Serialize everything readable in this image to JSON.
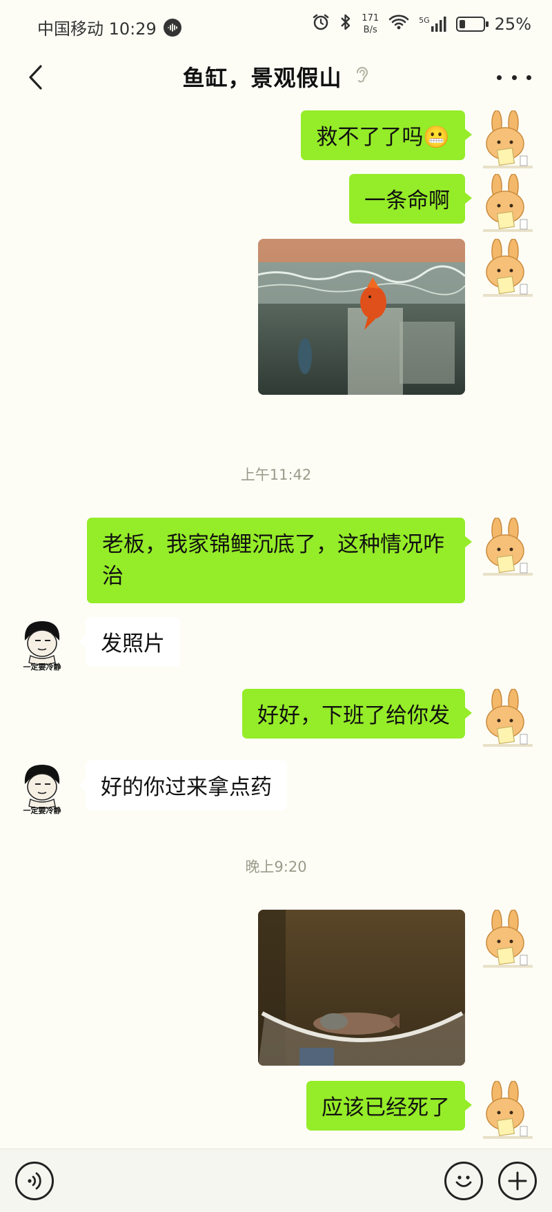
{
  "status_bar": {
    "carrier_time": "中国移动 10:29",
    "net_speed_value": "171",
    "net_speed_unit": "B/s",
    "network_type": "5G",
    "battery_percent": "25%",
    "battery_level": 0.25
  },
  "nav": {
    "title": "鱼缸，景观假山",
    "back_icon": "chevron-left-icon",
    "more_icon": "more-horizontal-icon",
    "mute_icon": "ear-icon"
  },
  "messages": [
    {
      "sender": "me",
      "type": "text",
      "text": "救不了了吗😬"
    },
    {
      "sender": "me",
      "type": "text",
      "text": "一条命啊"
    },
    {
      "sender": "me",
      "type": "image",
      "description_icon": "photo-goldfish-tank"
    },
    {
      "sender": "system",
      "type": "time",
      "text": "上午11:42"
    },
    {
      "sender": "me",
      "type": "text",
      "text": "老板，我家锦鲤沉底了，这种情况咋治"
    },
    {
      "sender": "other",
      "type": "text",
      "text": "发照片",
      "avatar_caption": "一定要冷静"
    },
    {
      "sender": "me",
      "type": "text",
      "text": "好好，下班了给你发"
    },
    {
      "sender": "other",
      "type": "text",
      "text": "好的你过来拿点药",
      "avatar_caption": "一定要冷静"
    },
    {
      "sender": "system",
      "type": "time",
      "text": "晚上9:20"
    },
    {
      "sender": "me",
      "type": "image",
      "description_icon": "photo-fish-bowl"
    },
    {
      "sender": "me",
      "type": "text",
      "text": "应该已经死了"
    }
  ],
  "bottom_bar": {
    "voice_icon": "voice-icon",
    "emoji_icon": "emoji-icon",
    "plus_icon": "plus-icon"
  },
  "colors": {
    "my_bubble": "#95ec28",
    "other_bubble": "#ffffff",
    "background": "#fdfdf6"
  }
}
